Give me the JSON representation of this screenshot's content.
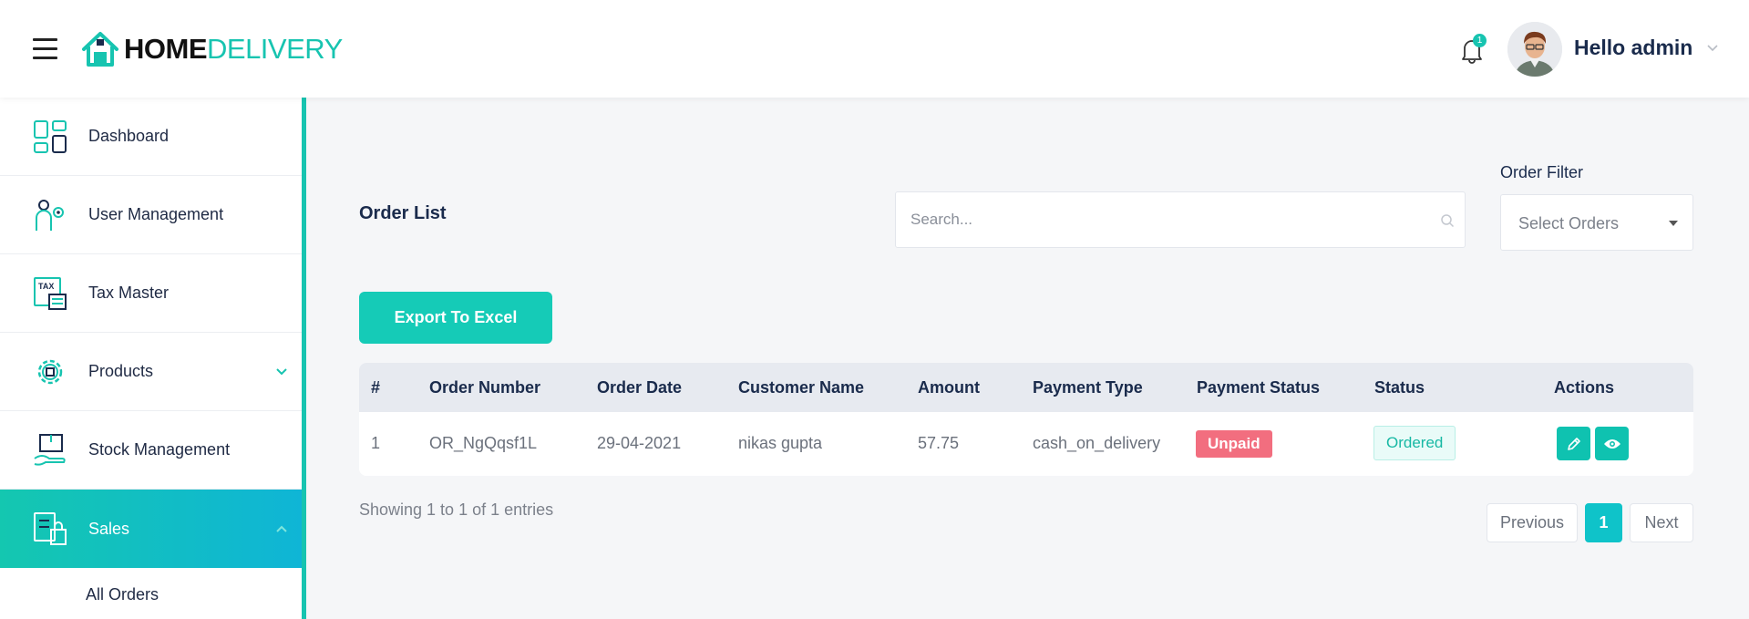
{
  "header": {
    "logo_bold": "HOME",
    "logo_light": "DELIVERY",
    "notification_count": "1",
    "user_greeting": "Hello admin",
    "accent_color": "#17c4b0"
  },
  "sidebar": {
    "items": [
      {
        "label": "Dashboard",
        "icon": "dashboard-icon"
      },
      {
        "label": "User Management",
        "icon": "user-settings-icon"
      },
      {
        "label": "Tax Master",
        "icon": "tax-icon"
      },
      {
        "label": "Products",
        "icon": "gear-icon"
      },
      {
        "label": "Stock Management",
        "icon": "box-hand-icon"
      },
      {
        "label": "Sales",
        "icon": "sales-checklist-icon"
      }
    ],
    "submenu": {
      "label": "All Orders"
    }
  },
  "main": {
    "title": "Order List",
    "search_placeholder": "Search...",
    "filter_label": "Order Filter",
    "filter_value": "Select Orders",
    "export_label": "Export To Excel",
    "table": {
      "headers": [
        "#",
        "Order Number",
        "Order Date",
        "Customer Name",
        "Amount",
        "Payment Type",
        "Payment Status",
        "Status",
        "Actions"
      ],
      "rows": [
        {
          "index": "1",
          "order_number": "OR_NgQqsf1L",
          "order_date": "29-04-2021",
          "customer_name": "nikas gupta",
          "amount": "57.75",
          "payment_type": "cash_on_delivery",
          "payment_status": "Unpaid",
          "status": "Ordered"
        }
      ]
    },
    "showing": "Showing 1 to 1 of 1 entries",
    "pagination": {
      "previous": "Previous",
      "current": "1",
      "next": "Next"
    }
  }
}
